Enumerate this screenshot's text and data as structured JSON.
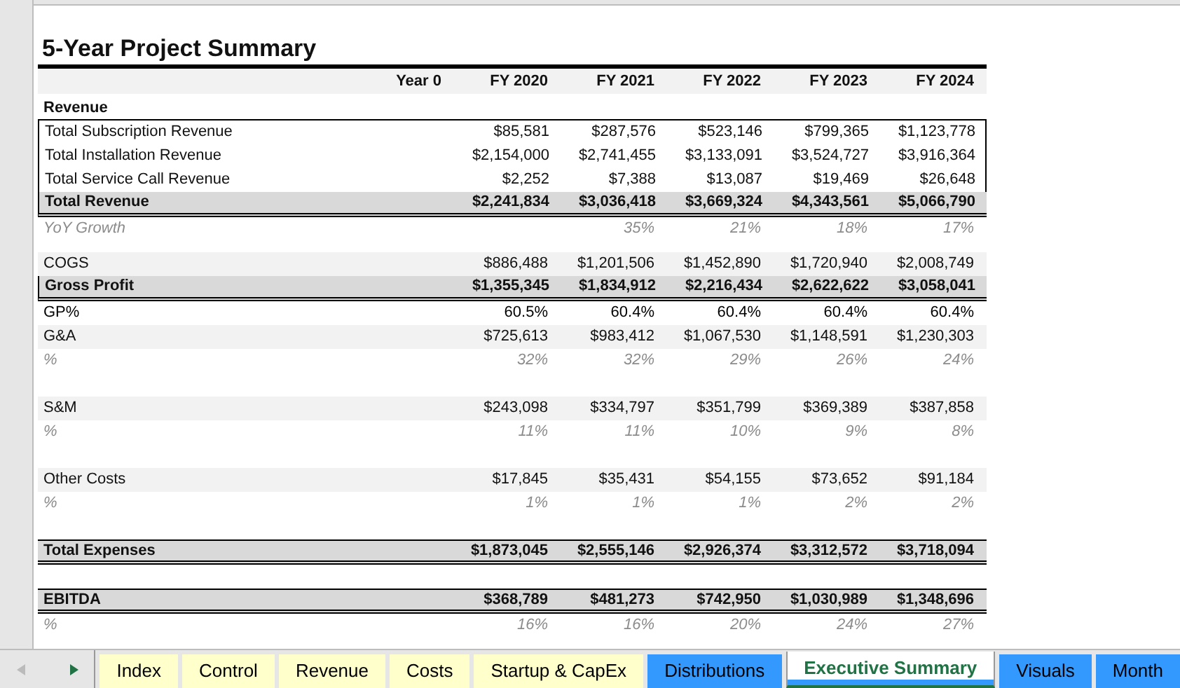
{
  "title": "5-Year Project Summary",
  "columns": [
    "Year 0",
    "FY 2020",
    "FY 2021",
    "FY 2022",
    "FY 2023",
    "FY 2024"
  ],
  "rows": [
    {
      "kind": "section",
      "label": "Revenue"
    },
    {
      "kind": "line",
      "label": "Total Subscription Revenue",
      "column_2": "$85,581",
      "column_3": "$287,576",
      "column_4": "$523,146",
      "column_5": "$799,365",
      "column_6": "$1,123,778"
    },
    {
      "kind": "line",
      "label": "Total Installation Revenue",
      "column_2": "$2,154,000",
      "column_3": "$2,741,455",
      "column_4": "$3,133,091",
      "column_5": "$3,524,727",
      "column_6": "$3,916,364"
    },
    {
      "kind": "line",
      "label": "Total Service Call Revenue",
      "column_2": "$2,252",
      "column_3": "$7,388",
      "column_4": "$13,087",
      "column_5": "$19,469",
      "column_6": "$26,648"
    },
    {
      "kind": "total",
      "label": "Total Revenue",
      "column_2": "$2,241,834",
      "column_3": "$3,036,418",
      "column_4": "$3,669,324",
      "column_5": "$4,343,561",
      "column_6": "$5,066,790"
    },
    {
      "kind": "pct",
      "label": "YoY Growth",
      "column_3": "35%",
      "column_4": "21%",
      "column_5": "18%",
      "column_6": "17%"
    },
    {
      "kind": "spacer_small"
    },
    {
      "kind": "expense",
      "label": "COGS",
      "column_2": "$886,488",
      "column_3": "$1,201,506",
      "column_4": "$1,452,890",
      "column_5": "$1,720,940",
      "column_6": "$2,008,749"
    },
    {
      "kind": "total",
      "label": "Gross Profit",
      "column_2": "$1,355,345",
      "column_3": "$1,834,912",
      "column_4": "$2,216,434",
      "column_5": "$2,622,622",
      "column_6": "$3,058,041"
    },
    {
      "kind": "ratio",
      "label": "GP%",
      "column_2": "60.5%",
      "column_3": "60.4%",
      "column_4": "60.4%",
      "column_5": "60.4%",
      "column_6": "60.4%"
    },
    {
      "kind": "expense",
      "label": "G&A",
      "column_2": "$725,613",
      "column_3": "$983,412",
      "column_4": "$1,067,530",
      "column_5": "$1,148,591",
      "column_6": "$1,230,303"
    },
    {
      "kind": "pct",
      "label": "%",
      "column_2": "32%",
      "column_3": "32%",
      "column_4": "29%",
      "column_5": "26%",
      "column_6": "24%"
    },
    {
      "kind": "spacer"
    },
    {
      "kind": "expense",
      "label": "S&M",
      "column_2": "$243,098",
      "column_3": "$334,797",
      "column_4": "$351,799",
      "column_5": "$369,389",
      "column_6": "$387,858"
    },
    {
      "kind": "pct",
      "label": "%",
      "column_2": "11%",
      "column_3": "11%",
      "column_4": "10%",
      "column_5": "9%",
      "column_6": "8%"
    },
    {
      "kind": "spacer"
    },
    {
      "kind": "expense",
      "label": "Other Costs",
      "column_2": "$17,845",
      "column_3": "$35,431",
      "column_4": "$54,155",
      "column_5": "$73,652",
      "column_6": "$91,184"
    },
    {
      "kind": "pct",
      "label": "%",
      "column_2": "1%",
      "column_3": "1%",
      "column_4": "1%",
      "column_5": "2%",
      "column_6": "2%"
    },
    {
      "kind": "spacer"
    },
    {
      "kind": "grand",
      "label": "Total Expenses",
      "column_2": "$1,873,045",
      "column_3": "$2,555,146",
      "column_4": "$2,926,374",
      "column_5": "$3,312,572",
      "column_6": "$3,718,094"
    },
    {
      "kind": "spacer"
    },
    {
      "kind": "grand",
      "label": "EBITDA",
      "column_2": "$368,789",
      "column_3": "$481,273",
      "column_4": "$742,950",
      "column_5": "$1,030,989",
      "column_6": "$1,348,696"
    },
    {
      "kind": "pct",
      "label": "%",
      "column_2": "16%",
      "column_3": "16%",
      "column_4": "20%",
      "column_5": "24%",
      "column_6": "27%"
    }
  ],
  "sheet_tabs": [
    {
      "label": "Index",
      "selected": false,
      "color": "#ffffcc"
    },
    {
      "label": "Control",
      "selected": false,
      "color": "#ffffcc"
    },
    {
      "label": "Revenue",
      "selected": false,
      "color": "#ffffcc"
    },
    {
      "label": "Costs",
      "selected": false,
      "color": "#ffffcc"
    },
    {
      "label": "Startup & CapEx",
      "selected": false,
      "color": "#ffffcc"
    },
    {
      "label": "Distributions",
      "selected": false,
      "color": "#3399ff"
    },
    {
      "label": "Executive Summary",
      "selected": true,
      "color": "#3399ff"
    },
    {
      "label": "Visuals",
      "selected": false,
      "color": "#3399ff"
    },
    {
      "label": "Month",
      "selected": false,
      "color": "#3399ff"
    }
  ]
}
